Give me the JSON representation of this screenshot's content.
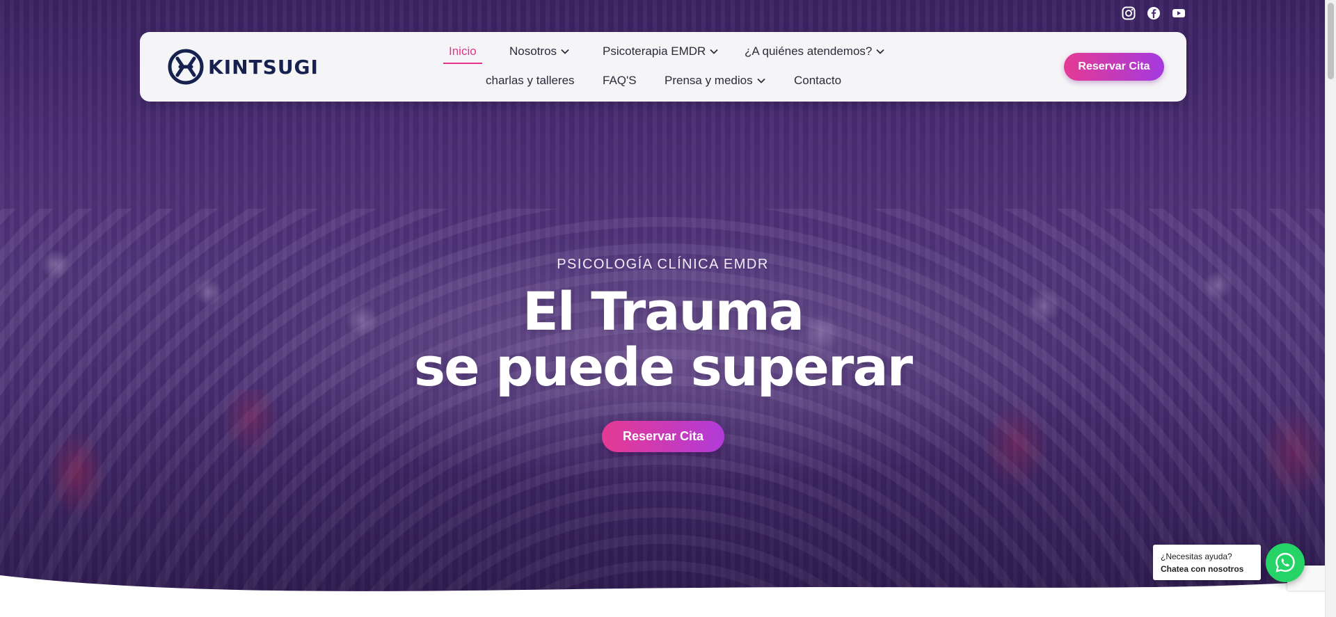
{
  "brand": {
    "name": "KINTSUGI",
    "logo_icon": "kintsugi-logo-icon"
  },
  "social": [
    {
      "name": "instagram-icon"
    },
    {
      "name": "facebook-icon"
    },
    {
      "name": "youtube-icon"
    }
  ],
  "nav": {
    "items": [
      {
        "label": "Inicio",
        "active": true
      },
      {
        "label": "Nosotros",
        "dropdown": true
      },
      {
        "label": "Psicoterapia EMDR",
        "dropdown": true
      },
      {
        "label": "¿A quiénes atendemos?",
        "dropdown": true
      },
      {
        "label": "charlas y talleres"
      },
      {
        "label": "FAQ'S"
      },
      {
        "label": "Prensa y medios",
        "dropdown": true
      },
      {
        "label": "Contacto"
      }
    ],
    "cta": "Reservar Cita"
  },
  "hero": {
    "eyebrow": "PSICOLOGÍA CLÍNICA EMDR",
    "title_line1": "El Trauma",
    "title_line2": "se puede superar",
    "cta": "Reservar Cita"
  },
  "chat": {
    "line1": "¿Necesitas ayuda?",
    "line2": "Chatea con nosotros",
    "icon": "whatsapp-icon"
  },
  "colors": {
    "accent": "#e3338f",
    "gradient_start": "#e53a93",
    "gradient_end": "#a43adf",
    "logo": "#16214f",
    "whatsapp": "#25d366"
  }
}
